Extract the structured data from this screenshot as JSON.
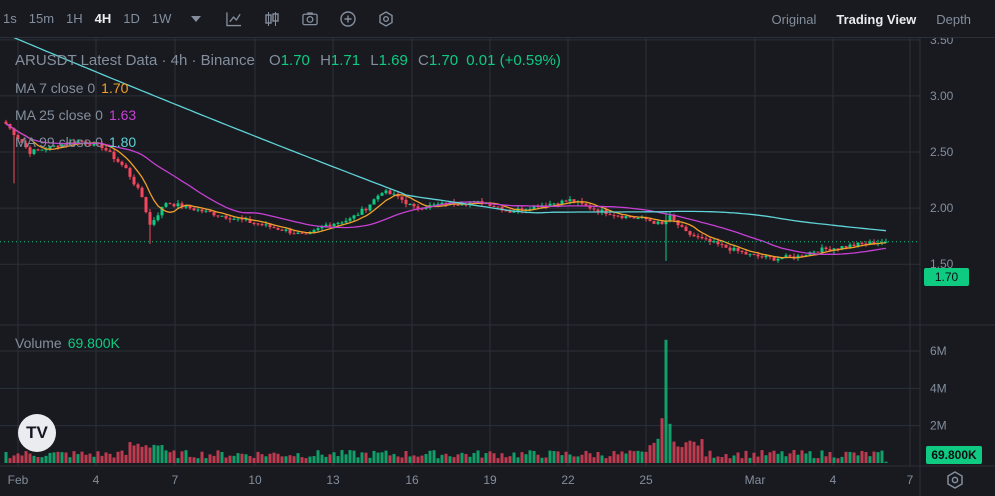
{
  "toolbar": {
    "timeframes": [
      "1s",
      "15m",
      "1H",
      "4H",
      "1D",
      "1W"
    ],
    "active_timeframe": "4H",
    "icons": [
      "chevron-down-icon",
      "indicator-icon",
      "candle-type-icon",
      "camera-icon",
      "add-icon",
      "settings-icon"
    ],
    "views": [
      "Original",
      "Trading View",
      "Depth"
    ],
    "active_view": "Trading View"
  },
  "legend": {
    "symbol": "ARUSDT Latest Data · 4h · Binance",
    "o_label": "O",
    "o_value": "1.70",
    "h_label": "H",
    "h_value": "1.71",
    "l_label": "L",
    "l_value": "1.69",
    "c_label": "C",
    "c_value": "1.70",
    "change": "0.01 (+0.59%)",
    "ma7_label": "MA 7 close 0",
    "ma7_value": "1.70",
    "ma7_color": "#f0a02a",
    "ma25_label": "MA 25 close 0",
    "ma25_value": "1.63",
    "ma25_color": "#c740d4",
    "ma99_label": "MA 99 close 0",
    "ma99_value": "1.80",
    "ma99_color": "#5fd3d6",
    "volume_label": "Volume",
    "volume_value": "69.800K"
  },
  "price_badge": "1.70",
  "volume_badge": "69.800K",
  "logo_text": "TV",
  "colors": {
    "up": "#0ecb81",
    "down": "#f6465d",
    "background": "#181a20",
    "grid": "#2b3139"
  },
  "chart_data": {
    "type": "candlestick",
    "title": "ARUSDT Latest Data · 4h · Binance",
    "x_ticks": [
      "Feb",
      "4",
      "7",
      "10",
      "13",
      "16",
      "19",
      "22",
      "25",
      "Mar",
      "4",
      "7"
    ],
    "y_ticks": [
      1.5,
      2.0,
      2.5,
      3.0,
      3.5
    ],
    "ylim": [
      1.35,
      3.65
    ],
    "volume_ticks": [
      "2M",
      "4M",
      "6M"
    ],
    "volume_ylim": [
      0,
      7500000
    ],
    "grid": true,
    "last_price": 1.7,
    "close_path": [
      [
        0,
        2.75
      ],
      [
        6,
        2.5
      ],
      [
        12,
        2.55
      ],
      [
        18,
        2.6
      ],
      [
        24,
        2.55
      ],
      [
        30,
        2.35
      ],
      [
        34,
        2.1
      ],
      [
        36,
        1.85
      ],
      [
        40,
        2.05
      ],
      [
        46,
        2.0
      ],
      [
        52,
        1.95
      ],
      [
        58,
        1.9
      ],
      [
        64,
        1.85
      ],
      [
        70,
        1.8
      ],
      [
        75,
        1.75
      ],
      [
        80,
        1.85
      ],
      [
        86,
        1.9
      ],
      [
        90,
        2.0
      ],
      [
        94,
        2.15
      ],
      [
        98,
        2.1
      ],
      [
        102,
        2.0
      ],
      [
        108,
        2.03
      ],
      [
        114,
        2.05
      ],
      [
        120,
        2.05
      ],
      [
        126,
        1.97
      ],
      [
        132,
        2.02
      ],
      [
        138,
        2.05
      ],
      [
        141,
        2.07
      ],
      [
        148,
        1.98
      ],
      [
        154,
        1.93
      ],
      [
        160,
        1.9
      ],
      [
        164,
        1.85
      ],
      [
        166,
        1.92
      ],
      [
        170,
        1.78
      ],
      [
        174,
        1.72
      ],
      [
        180,
        1.65
      ],
      [
        186,
        1.58
      ],
      [
        192,
        1.55
      ],
      [
        198,
        1.57
      ],
      [
        202,
        1.62
      ],
      [
        208,
        1.65
      ],
      [
        214,
        1.68
      ],
      [
        219,
        1.7
      ]
    ],
    "big_volume_index": 165
  }
}
